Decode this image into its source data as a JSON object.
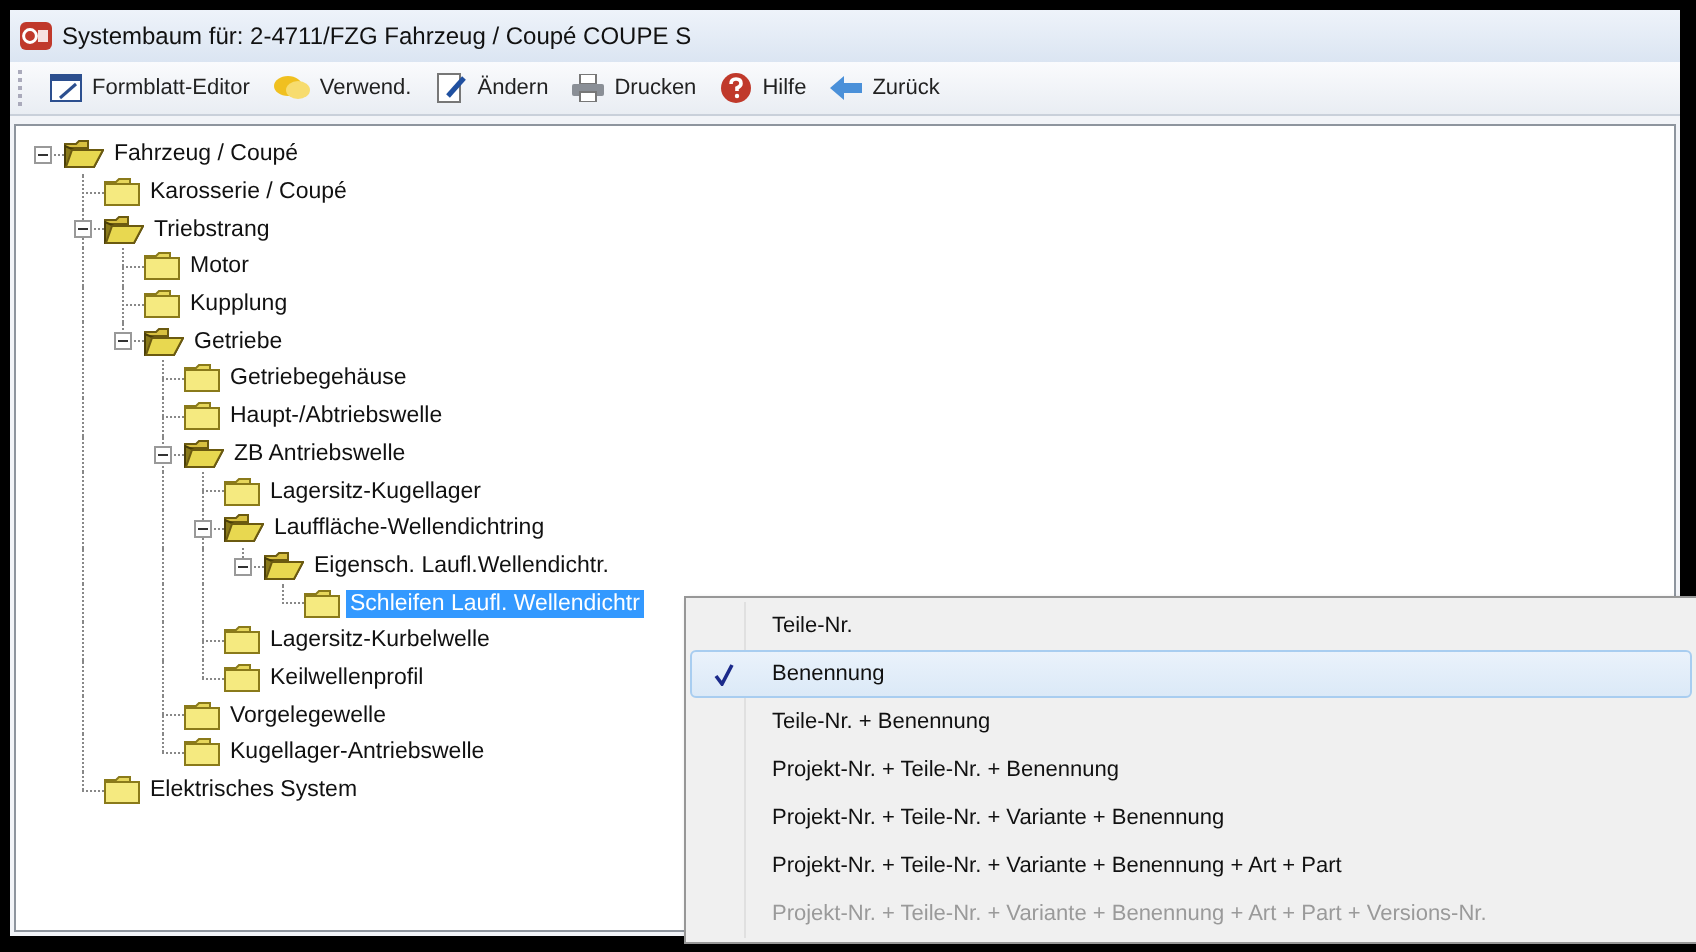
{
  "window": {
    "title": "Systembaum für: 2-4711/FZG  Fahrzeug / Coupé  COUPE  S"
  },
  "toolbar": [
    {
      "kind": "form",
      "label": "Formblatt-Editor"
    },
    {
      "kind": "chat",
      "label": "Verwend."
    },
    {
      "kind": "edit",
      "label": "Ändern"
    },
    {
      "kind": "print",
      "label": "Drucken"
    },
    {
      "kind": "help",
      "label": "Hilfe"
    },
    {
      "kind": "back",
      "label": "Zurück"
    }
  ],
  "tree": [
    {
      "label": "Fahrzeug / Coupé",
      "expanded": true,
      "selected": false,
      "children": [
        {
          "label": "Karosserie / Coupé",
          "selected": false
        },
        {
          "label": "Triebstrang",
          "expanded": true,
          "selected": false,
          "children": [
            {
              "label": "Motor",
              "selected": false
            },
            {
              "label": "Kupplung",
              "selected": false
            },
            {
              "label": "Getriebe",
              "expanded": true,
              "selected": false,
              "children": [
                {
                  "label": "Getriebegehäuse",
                  "selected": false
                },
                {
                  "label": "Haupt-/Abtriebswelle",
                  "selected": false
                },
                {
                  "label": "ZB Antriebswelle",
                  "expanded": true,
                  "selected": false,
                  "children": [
                    {
                      "label": "Lagersitz-Kugellager",
                      "selected": false
                    },
                    {
                      "label": "Lauffläche-Wellendichtring",
                      "expanded": true,
                      "selected": false,
                      "children": [
                        {
                          "label": "Eigensch. Laufl.Wellendichtr.",
                          "expanded": true,
                          "selected": false,
                          "children": [
                            {
                              "label": "Schleifen Laufl. Wellendichtr",
                              "selected": true
                            }
                          ]
                        }
                      ]
                    },
                    {
                      "label": "Lagersitz-Kurbelwelle",
                      "selected": false
                    },
                    {
                      "label": "Keilwellenprofil",
                      "selected": false
                    }
                  ]
                },
                {
                  "label": "Vorgelegewelle",
                  "selected": false
                },
                {
                  "label": "Kugellager-Antriebswelle",
                  "selected": false
                }
              ]
            }
          ]
        },
        {
          "label": "Elektrisches System",
          "selected": false
        }
      ]
    }
  ],
  "context_menu": [
    {
      "label": "Teile-Nr.",
      "checked": false,
      "disabled": false
    },
    {
      "label": "Benennung",
      "checked": true,
      "disabled": false
    },
    {
      "label": "Teile-Nr. + Benennung",
      "checked": false,
      "disabled": false
    },
    {
      "label": "Projekt-Nr. + Teile-Nr. + Benennung",
      "checked": false,
      "disabled": false
    },
    {
      "label": "Projekt-Nr. + Teile-Nr. + Variante + Benennung",
      "checked": false,
      "disabled": false
    },
    {
      "label": "Projekt-Nr. + Teile-Nr. + Variante + Benennung + Art + Part",
      "checked": false,
      "disabled": false
    },
    {
      "label": "Projekt-Nr. + Teile-Nr. + Variante + Benennung + Art + Part + Versions-Nr.",
      "checked": false,
      "disabled": true
    }
  ]
}
